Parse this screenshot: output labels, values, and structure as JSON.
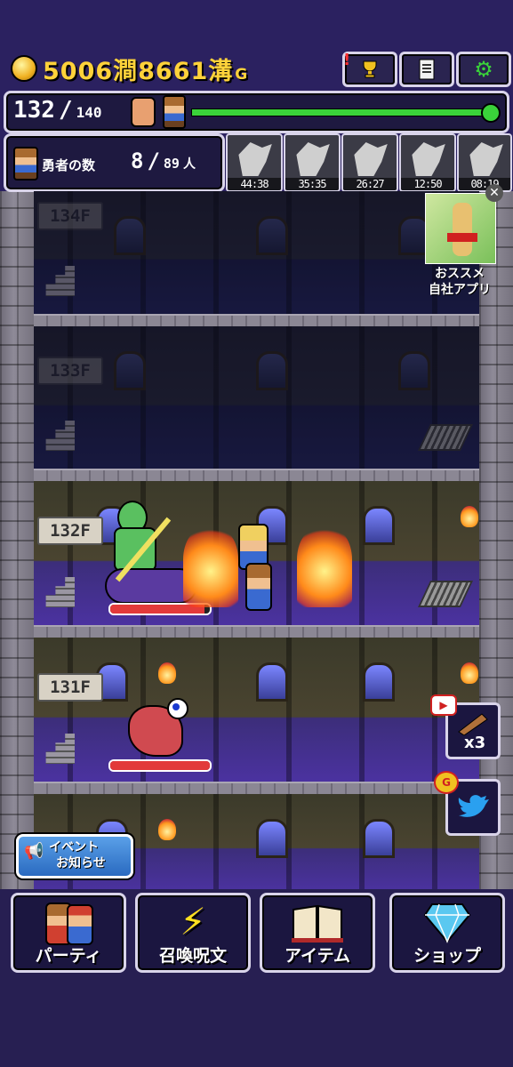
{
  "hud": {
    "gold": "5006澗8661溝",
    "gold_unit": "G",
    "floor_current": "132",
    "floor_sep": "/",
    "floor_max": "140",
    "progress": 1.0,
    "heroes_label": "勇者の数",
    "heroes_current": "8",
    "heroes_sep": "/",
    "heroes_max": "89",
    "heroes_unit": "人"
  },
  "monster_timers": [
    "44:38",
    "35:35",
    "26:27",
    "12:50",
    "08:19"
  ],
  "ad": {
    "label_line1": "おススメ",
    "label_line2": "自社アプリ"
  },
  "floors": [
    {
      "label": "134F",
      "dark": true
    },
    {
      "label": "133F",
      "dark": true
    },
    {
      "label": "132F",
      "dark": false,
      "enemy_hp": 0.95
    },
    {
      "label": "131F",
      "dark": false,
      "enemy_hp": 1.0
    }
  ],
  "side": {
    "speed_label": "x3"
  },
  "event": {
    "line1": "イベント",
    "line2": "お知らせ"
  },
  "menu": {
    "party": "パーティ",
    "summon": "召喚呪文",
    "item": "アイテム",
    "shop": "ショップ"
  },
  "colors": {
    "gold_text": "#ffd23a",
    "progress": "#3ad23a",
    "hp": "#e23a3a"
  }
}
